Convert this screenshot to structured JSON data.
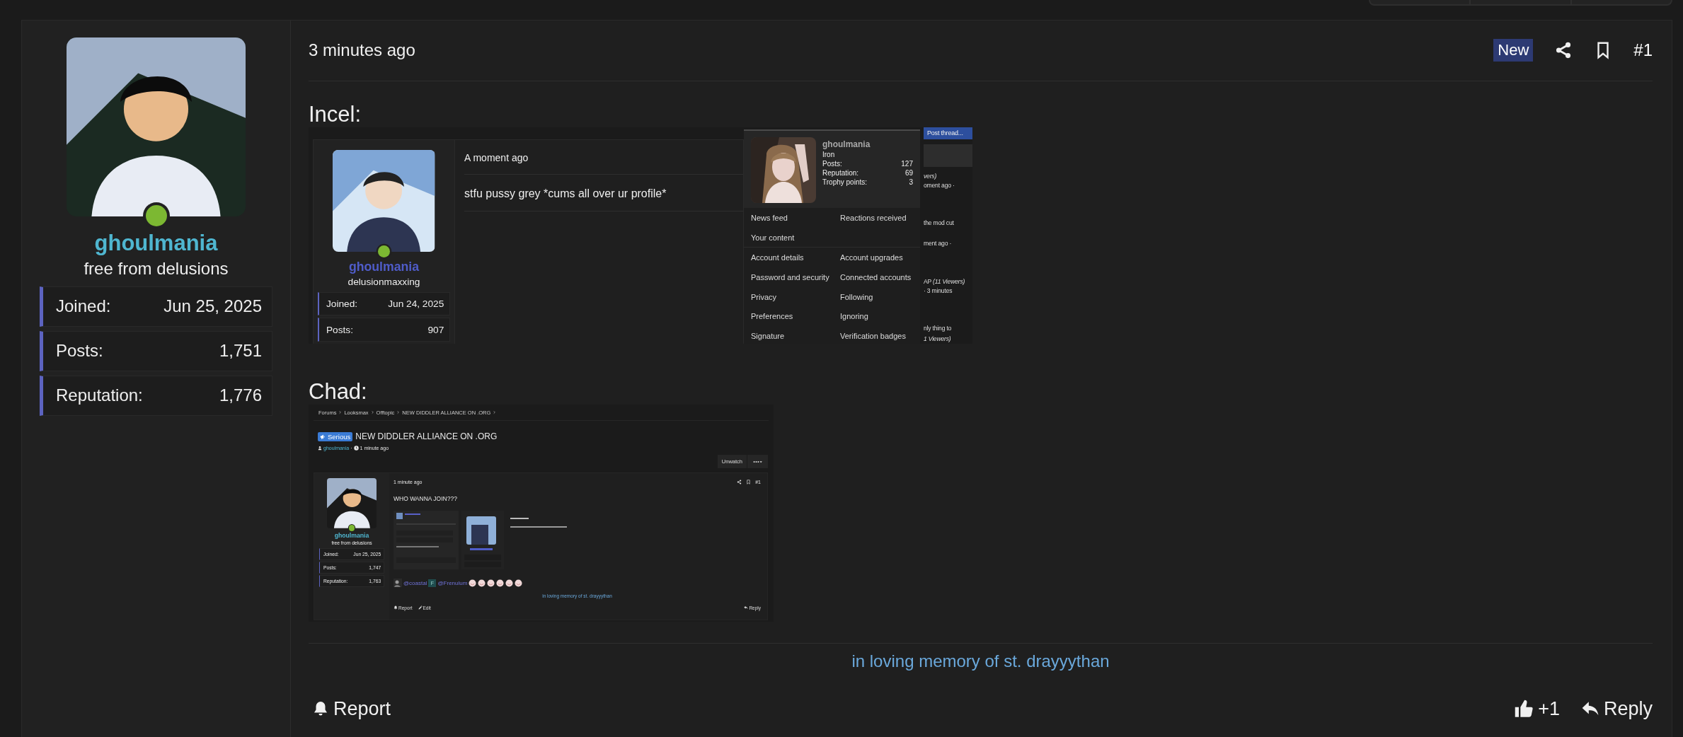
{
  "author": {
    "username": "ghoulmania",
    "user_title": "free from delusions",
    "online": true,
    "stats": [
      {
        "label": "Joined:",
        "value": "Jun 25, 2025"
      },
      {
        "label": "Posts:",
        "value": "1,751"
      },
      {
        "label": "Reputation:",
        "value": "1,776"
      }
    ]
  },
  "post": {
    "time": "3 minutes ago",
    "badge": "New",
    "number": "#1",
    "sections": [
      {
        "heading": "Incel:",
        "screenshot": {
          "kind": "profile_menu",
          "author": {
            "username": "ghoulmania",
            "user_title": "delusionmaxxing",
            "online": true,
            "stats": [
              {
                "label": "Joined:",
                "value": "Jun 24, 2025"
              },
              {
                "label": "Posts:",
                "value": "907"
              }
            ]
          },
          "time": "A moment ago",
          "body": "stfu pussy grey *cums all over ur profile*",
          "menu": {
            "username": "ghoulmania",
            "rank": "Iron",
            "stats": [
              {
                "label": "Posts:",
                "value": "127"
              },
              {
                "label": "Reputation:",
                "value": "69"
              },
              {
                "label": "Trophy points:",
                "value": "3"
              }
            ],
            "link_groups": [
              [
                "News feed",
                "Reactions received",
                "Your content"
              ],
              [
                "Account details",
                "Account upgrades",
                "Password and security",
                "Connected accounts",
                "Privacy",
                "Following",
                "Preferences",
                "Ignoring",
                "Signature",
                "Verification badges"
              ]
            ]
          },
          "side_button": "Post thread...",
          "side_texts": [
            {
              "text": "vers)",
              "italic": true
            },
            {
              "text": "oment ago ·",
              "italic": false
            },
            {
              "text": "the mod cut",
              "italic": false
            },
            {
              "text": "ment ago ·",
              "italic": false
            },
            {
              "text": "AP *(11 Viewers)*",
              "italic": false
            },
            {
              "text": "· 3 minutes",
              "italic": false
            },
            {
              "text": "nly thing to",
              "italic": false
            },
            {
              "text": "1 Viewers)",
              "italic": true
            }
          ]
        }
      },
      {
        "heading": "Chad:",
        "screenshot": {
          "kind": "thread_page",
          "breadcrumbs": [
            "Forums",
            "Looksmax",
            "Offtopic",
            "NEW DIDDLER ALLIANCE ON .ORG"
          ],
          "prefix": "Serious",
          "title": "NEW DIDDLER ALLIANCE ON .ORG",
          "starter": "ghoulmania",
          "separator": "·",
          "started": "1 minute ago",
          "watch_button": "Unwatch",
          "author": {
            "username": "ghoulmania",
            "user_title": "free from delusions",
            "online": true,
            "stats": [
              {
                "label": "Joined:",
                "value": "Jun 25, 2025"
              },
              {
                "label": "Posts:",
                "value": "1,747"
              },
              {
                "label": "Reputation:",
                "value": "1,763"
              }
            ]
          },
          "time": "1 minute ago",
          "number": "#1",
          "body": "WHO WANNA JOIN???",
          "mentions": [
            {
              "kind": "image",
              "name": "@coastal"
            },
            {
              "kind": "letter",
              "letter": "F",
              "name": "@Frenulum"
            }
          ],
          "signature": "in loving memory of st. drayyythan",
          "actions": {
            "report": "Report",
            "edit": "Edit",
            "reply": "Reply"
          }
        }
      }
    ],
    "signature": "in loving memory of st. drayyythan",
    "actions": {
      "report": "Report",
      "likes": "+1",
      "reply": "Reply"
    }
  }
}
